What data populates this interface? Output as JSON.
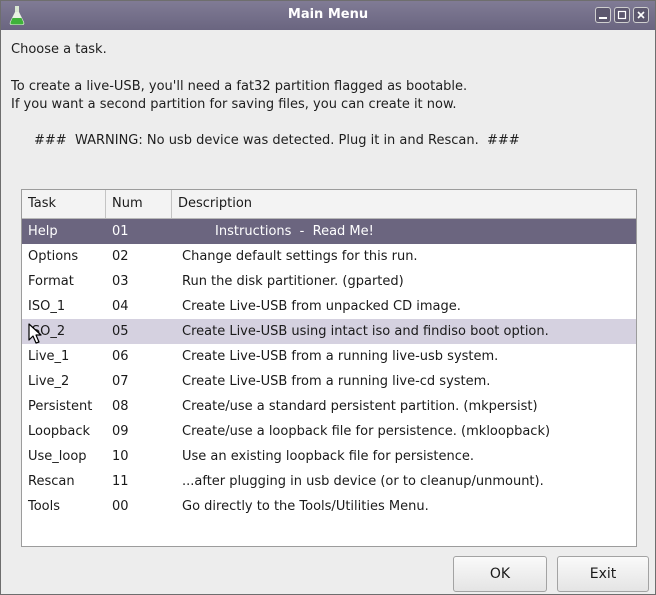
{
  "window": {
    "title": "Main Menu"
  },
  "intro": {
    "prompt": "Choose a task.",
    "line1": "To create a live-USB, you'll need a fat32 partition flagged as bootable.",
    "line2": "If you want a second partition for saving files, you can create it now.",
    "warning": "###  WARNING: No usb device was detected. Plug it in and Rescan.  ###"
  },
  "table": {
    "headers": [
      "Task",
      "Num",
      "Description"
    ],
    "rows": [
      {
        "task": "Help",
        "num": "01",
        "desc": "        Instructions  -  Read Me!"
      },
      {
        "task": "Options",
        "num": "02",
        "desc": "Change default settings for this run."
      },
      {
        "task": "Format",
        "num": "03",
        "desc": "Run the disk partitioner. (gparted)"
      },
      {
        "task": "ISO_1",
        "num": "04",
        "desc": "Create Live-USB from unpacked CD image."
      },
      {
        "task": "ISO_2",
        "num": "05",
        "desc": "Create Live-USB using intact iso and findiso boot option."
      },
      {
        "task": "Live_1",
        "num": "06",
        "desc": "Create Live-USB from a running live-usb system."
      },
      {
        "task": "Live_2",
        "num": "07",
        "desc": "Create Live-USB from a running live-cd system."
      },
      {
        "task": "Persistent",
        "num": "08",
        "desc": "Create/use a standard persistent partition. (mkpersist)"
      },
      {
        "task": "Loopback",
        "num": "09",
        "desc": "Create/use a loopback file for persistence. (mkloopback)"
      },
      {
        "task": "Use_loop",
        "num": "10",
        "desc": "Use an existing loopback file for persistence."
      },
      {
        "task": "Rescan",
        "num": "11",
        "desc": "...after plugging in usb device (or to cleanup/unmount)."
      },
      {
        "task": "Tools",
        "num": "00",
        "desc": "Go directly to the Tools/Utilities Menu."
      }
    ],
    "selected_row": "Help",
    "hovered_row": "ISO_2"
  },
  "buttons": {
    "ok": "OK",
    "exit": "Exit"
  },
  "colors": {
    "titlebar": "#6a6580",
    "selected": "#6b657f",
    "hover": "#d5d1e0"
  }
}
